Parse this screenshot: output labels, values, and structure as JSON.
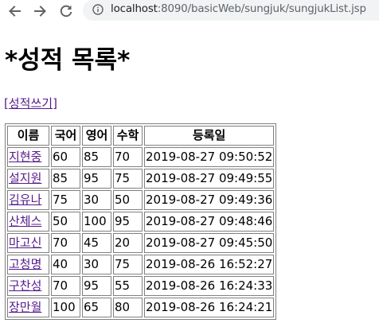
{
  "browser": {
    "url_host": "localhost",
    "url_path": ":8090/basicWeb/sungjuk/sungjukList.jsp",
    "icons": {
      "back": "arrow-left-icon",
      "forward": "arrow-right-icon",
      "reload": "reload-icon",
      "info": "info-icon"
    }
  },
  "page": {
    "title": "*성적 목록*",
    "write_link": "성적쓰기",
    "write_link_open": "[",
    "write_link_close": "]"
  },
  "table": {
    "headers": [
      "이름",
      "국어",
      "영어",
      "수학",
      "등록일"
    ],
    "rows": [
      {
        "name": "지현중",
        "kor": "60",
        "eng": "85",
        "math": "70",
        "date": "2019-08-27 09:50:52"
      },
      {
        "name": "설지원",
        "kor": "85",
        "eng": "95",
        "math": "75",
        "date": "2019-08-27 09:49:55"
      },
      {
        "name": "김유나",
        "kor": "75",
        "eng": "30",
        "math": "50",
        "date": "2019-08-27 09:49:36"
      },
      {
        "name": "산체스",
        "kor": "50",
        "eng": "100",
        "math": "95",
        "date": "2019-08-27 09:48:46"
      },
      {
        "name": "마고신",
        "kor": "70",
        "eng": "45",
        "math": "20",
        "date": "2019-08-27 09:45:50"
      },
      {
        "name": "고청명",
        "kor": "40",
        "eng": "30",
        "math": "75",
        "date": "2019-08-26 16:52:27"
      },
      {
        "name": "구찬성",
        "kor": "70",
        "eng": "95",
        "math": "55",
        "date": "2019-08-26 16:24:33"
      },
      {
        "name": "장만월",
        "kor": "100",
        "eng": "65",
        "math": "80",
        "date": "2019-08-26 16:24:21"
      }
    ]
  },
  "colors": {
    "link_visited": "#551a8b",
    "omnibox_bg": "#f1f3f4",
    "icon": "#5f6368"
  }
}
